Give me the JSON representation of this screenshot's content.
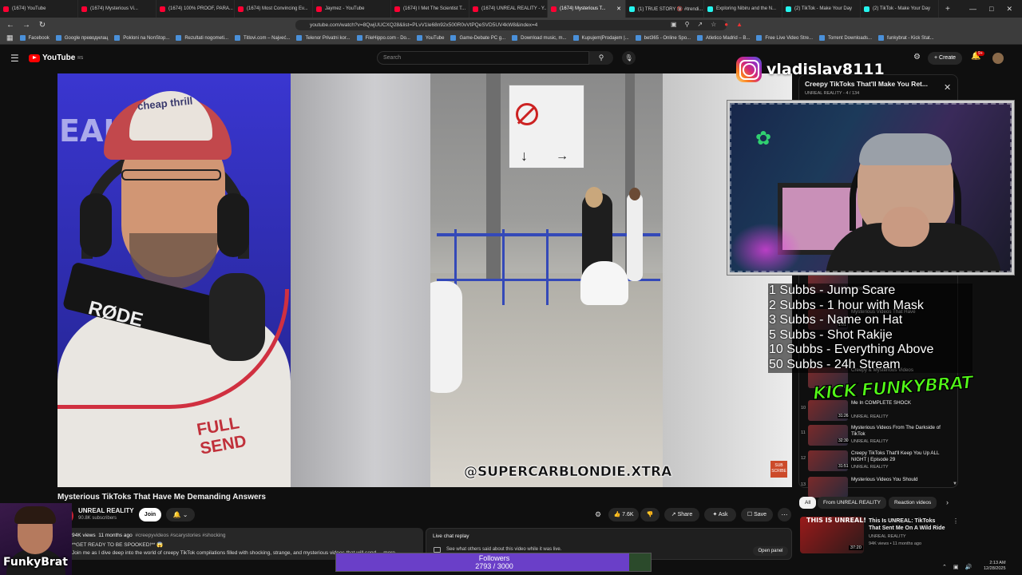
{
  "browser": {
    "tabs": [
      {
        "title": "(1674) YouTube",
        "icon": "youtube-icon"
      },
      {
        "title": "(1674) Mysterious Vi...",
        "icon": "youtube-icon"
      },
      {
        "title": "(1674) 100% PROOF, PARA...",
        "icon": "youtube-icon"
      },
      {
        "title": "(1674) Most Convincing Ev...",
        "icon": "youtube-icon"
      },
      {
        "title": "Jaymez - YouTube",
        "icon": "youtube-icon"
      },
      {
        "title": "(1674) I Met The Scientist T...",
        "icon": "youtube-icon"
      },
      {
        "title": "(1674) UNREAL REALITY - Y...",
        "icon": "youtube-icon"
      },
      {
        "title": "(1674) Mysterious T...",
        "icon": "youtube-icon",
        "active": true
      },
      {
        "title": "(1) TRUE STORY 🔞 #trendi...",
        "icon": "tiktok-icon"
      },
      {
        "title": "Exploring Nibiru and the N...",
        "icon": "tiktok-icon"
      },
      {
        "title": "(2) TikTok - Make Your Day",
        "icon": "tiktok-icon"
      },
      {
        "title": "(2) TikTok - Make Your Day",
        "icon": "tiktok-icon"
      }
    ],
    "new_tab_label": "+",
    "url": "youtube.com/watch?v=8QwjUUCXQ28&list=PLvV1le68n92x500R0vVtPQeSVD5UV4kW8&index=4",
    "bookmarks": [
      "Facebook",
      "Google преводилац",
      "Pokloni na NonStop...",
      "Rezultati nogometi...",
      "Titlovi.com – Najveć...",
      "Telenor Privatni kor...",
      "FileHippo.com - Do...",
      "YouTube",
      "Game-Debate PC g...",
      "Download music, m...",
      "Kupujem|Prodajem |...",
      "bet365 - Online Spo...",
      "Atletico Madrid – B...",
      "Free Live Video Stre...",
      "Torrent Downloads...",
      "funkybrat - Kick Stat..."
    ]
  },
  "youtube": {
    "logo_text": "YouTube",
    "logo_region": "RS",
    "search_placeholder": "Search",
    "create_label": "Create",
    "notif_count": "9+"
  },
  "video": {
    "title": "Mysterious TikToks That Have Me Demanding Answers",
    "watermark": "@SUPERCARBLONDIE.XTRA",
    "cap_text": "cheap thrill",
    "wall_text": "EAL",
    "mic_brand": "RØDE",
    "shirt_text": "FULL SEND",
    "subscribe_badge": "SUB SCRIBE",
    "channel": {
      "name": "UNREAL REALITY",
      "subs": "90.8K subscribers",
      "join_label": "Join"
    },
    "actions": {
      "likes": "7.6K",
      "share": "Share",
      "ask": "Ask",
      "save": "Save"
    },
    "description": {
      "views": "94K views",
      "age": "11 months ago",
      "tags": "#creepyvideos #scarystories #shocking",
      "line1": "**GET READY TO BE SPOOKED!** 😱",
      "line2": "Join me as I dive deep into the world of creepy TikTok compilations filled with shocking, strange, and mysterious videos that will send ... more"
    },
    "live_chat": {
      "title": "Live chat replay",
      "subtitle": "See what others said about this video while it was live.",
      "open_label": "Open panel"
    }
  },
  "playlist": {
    "title": "Creepy TikToks That'll Make You Ret...",
    "subtitle": "UNREAL REALITY - 4 / 134",
    "items": [
      {
        "num": "",
        "title": "",
        "channel": "UNREAL REALITY",
        "dur": ""
      },
      {
        "num": "",
        "title": "Mysterious Videos That Have",
        "channel": "",
        "dur": "1:01"
      },
      {
        "num": "",
        "title": "Creepy & Mysterious Videos",
        "channel": "",
        "dur": ""
      },
      {
        "num": "10",
        "title": "Me In COMPLETE SHOCK",
        "channel": "UNREAL REALITY",
        "dur": "31:26"
      },
      {
        "num": "11",
        "title": "Mysterious Videos From The Darkside of TikTok",
        "channel": "UNREAL REALITY",
        "dur": "32:30"
      },
      {
        "num": "12",
        "title": "Creepy TikToks That'll Keep You Up ALL NIGHT | Episode 29",
        "channel": "UNREAL REALITY",
        "dur": "31:51"
      },
      {
        "num": "13",
        "title": "Mysterious Videos You Should",
        "channel": "",
        "dur": ""
      }
    ]
  },
  "chips": [
    "All",
    "From UNREAL REALITY",
    "Reaction videos"
  ],
  "suggested": {
    "thumb_text": "THIS IS UNREAL!",
    "title": "This Is UNREAL: TikToks That Sent Me On A Wild Ride",
    "channel": "UNREAL REALITY",
    "meta": "94K views • 11 months ago",
    "dur": "37:20"
  },
  "overlay": {
    "instagram": "vladislav8111",
    "goals": [
      "1 Subbs - Jump Scare",
      "2 Subbs - 1 hour with Mask",
      "3 Subbs - Name on Hat",
      "5 Subbs - Shot Rakije",
      "10 Subbs - Everything Above",
      "50 Subbs - 24h Stream"
    ],
    "kick_text": "KICK FUNKYBRAT",
    "streamer_name": "FunkyBrat",
    "followers_label": "Followers",
    "followers_current": 2793,
    "followers_goal": 3000,
    "followers_text": "2793 / 3000"
  },
  "system": {
    "time": "2:13 AM",
    "date": "12/28/2025"
  }
}
